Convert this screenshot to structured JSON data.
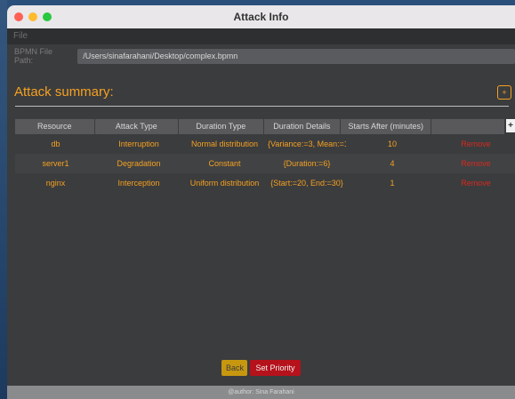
{
  "window": {
    "title": "Attack Info"
  },
  "menu": {
    "file": "File"
  },
  "path": {
    "label": "BPMN File Path:",
    "value": "/Users/sinafarahani/Desktop/complex.bpmn"
  },
  "summary": {
    "title": "Attack summary:",
    "add_label": "+"
  },
  "table": {
    "headers": [
      "Resource",
      "Attack Type",
      "Duration Type",
      "Duration Details",
      "Starts After (minutes)",
      ""
    ],
    "add_column_label": "+",
    "rows": [
      {
        "resource": "db",
        "attack_type": "Interruption",
        "duration_type": "Normal distribution",
        "duration_details": "{Variance:=3, Mean:=1...",
        "starts_after": "10",
        "action": "Remove"
      },
      {
        "resource": "server1",
        "attack_type": "Degradation",
        "duration_type": "Constant",
        "duration_details": "{Duration:=6}",
        "starts_after": "4",
        "action": "Remove"
      },
      {
        "resource": "nginx",
        "attack_type": "Interception",
        "duration_type": "Uniform distribution",
        "duration_details": "{Start:=20, End:=30}",
        "starts_after": "1",
        "action": "Remove"
      }
    ]
  },
  "buttons": {
    "back": "Back",
    "set_priority": "Set Priority"
  },
  "footer": {
    "text": "@author: Sina Farahani"
  },
  "colors": {
    "accent": "#f5a121",
    "remove": "#d42a1f",
    "back": "#c79710",
    "priority": "#b5121b"
  }
}
